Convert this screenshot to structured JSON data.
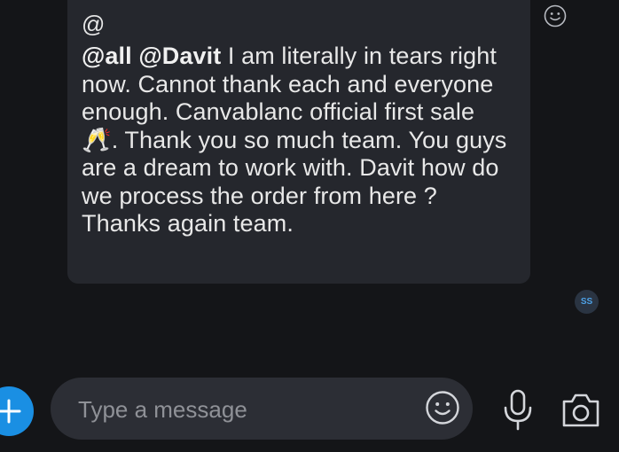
{
  "message": {
    "mention_prefix": "@",
    "mention_all": "@all",
    "mention_user": "@Davit",
    "body_line1": " I am literally in tears",
    "body_rest": "right now. Cannot thank each and everyone enough. Canvablanc official first sale 🥂. Thank you so much team. You guys are a dream to work with. Davit how do we process the order from here ? Thanks again team."
  },
  "read_receipt": {
    "initials": "SS"
  },
  "composer": {
    "placeholder": "Type a message",
    "value": ""
  },
  "icons": {
    "add": "plus-icon",
    "reaction": "smiley-icon",
    "emoji": "smiley-icon",
    "mic": "microphone-icon",
    "camera": "camera-icon"
  },
  "colors": {
    "background": "#141518",
    "bubble": "#25272d",
    "accent": "#1a8fe3",
    "input_pill": "#2c2e35",
    "placeholder": "#8f9197"
  }
}
